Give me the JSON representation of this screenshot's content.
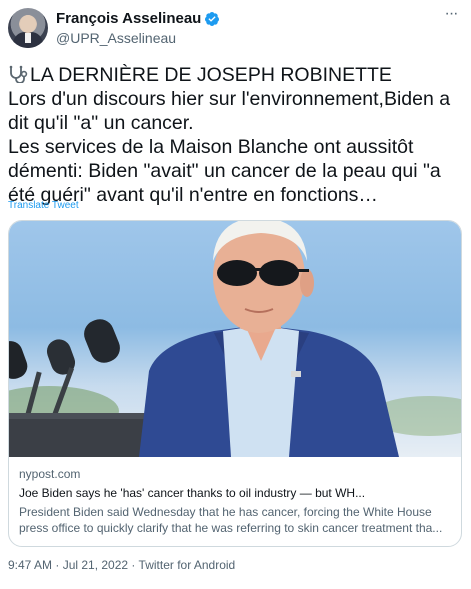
{
  "author": {
    "display_name": "François Asselineau",
    "handle": "@UPR_Asselineau",
    "avatar_icon": "profile-photo",
    "verified_icon": "verified-badge-icon",
    "verified_color": "#1d9bf0"
  },
  "tweet": {
    "lead_icon": "stethoscope-icon",
    "text": "LA DERNIÈRE DE JOSEPH ROBINETTE\nLors d'un discours hier sur l'environnement,Biden a dit qu'il \"a\" un cancer.\nLes services de la Maison Blanche ont aussitôt démenti: Biden \"avait\" un cancer de la peau qui \"a été guéri\" avant qu'il n'entre en fonctions…",
    "translate_label": "Translate Tweet"
  },
  "card": {
    "domain": "nypost.com",
    "title": "Joe Biden says he 'has' cancer thanks to oil industry — but WH...",
    "description": "President Biden said Wednesday that he has cancer, forcing the White House press office to quickly clarify that he was referring to skin cancer treatment tha..."
  },
  "footer": {
    "timestamp": "9:47 AM · Jul 21, 2022 · Twitter for Android"
  },
  "colors": {
    "link": "#1d9bf0",
    "secondary_text": "#536471",
    "border": "#cfd9de"
  }
}
